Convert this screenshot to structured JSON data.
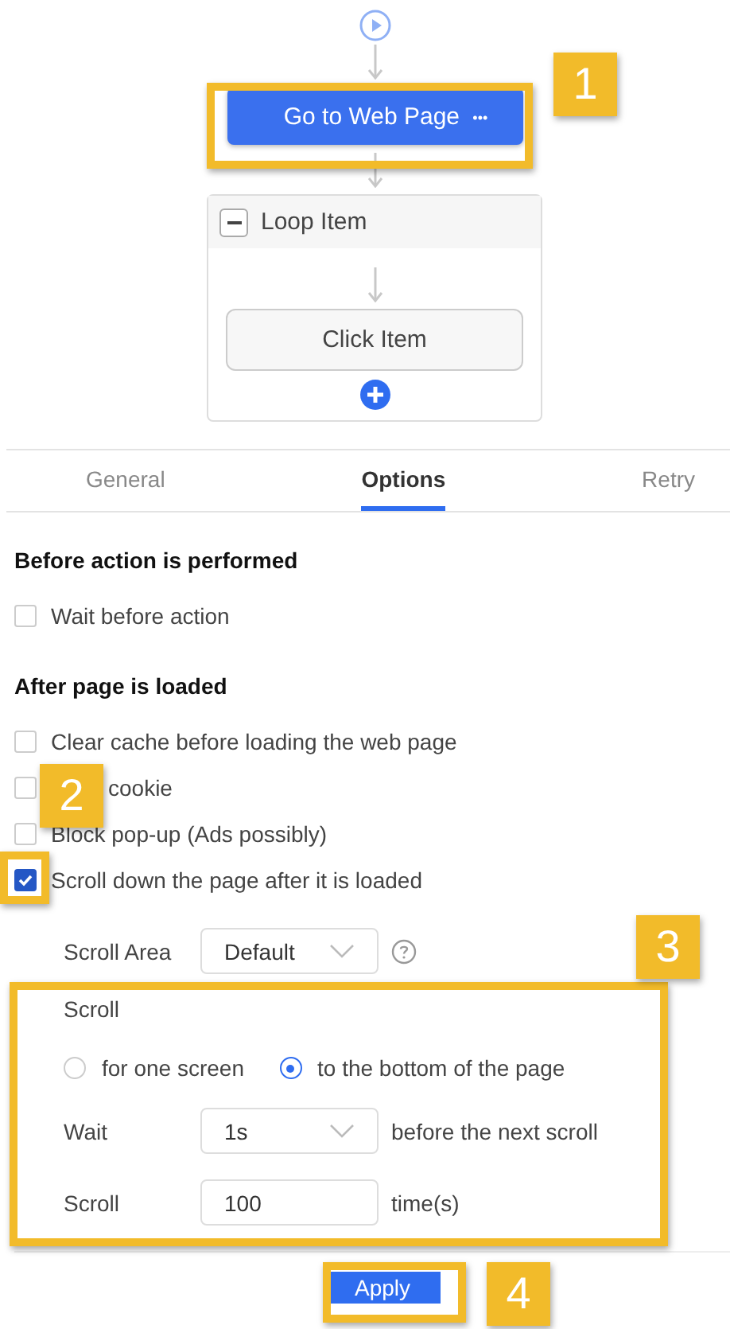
{
  "flow": {
    "start": {
      "kind": "start"
    },
    "step": {
      "label": "Go to Web Page",
      "more": "•••"
    },
    "loop": {
      "title": "Loop Item",
      "expanded": true,
      "children": [
        {
          "label": "Click Item"
        }
      ]
    }
  },
  "tabs": [
    {
      "label": "General",
      "selected": false
    },
    {
      "label": "Options",
      "selected": true
    },
    {
      "label": "Retry",
      "selected": false
    }
  ],
  "sections": [
    {
      "title": "Before action is performed",
      "options": [
        {
          "label": "Wait before action",
          "checked": false
        }
      ]
    },
    {
      "title": "After page is loaded",
      "options": [
        {
          "label": "Clear cache before loading the web page",
          "checked": false
        },
        {
          "label": "cookie",
          "checked": false
        },
        {
          "label": "Block pop-up (Ads possibly)",
          "checked": false
        },
        {
          "label": "Scroll down the page after it is loaded",
          "checked": true
        }
      ]
    }
  ],
  "scroll_area": {
    "label": "Scroll Area",
    "value": "Default"
  },
  "scroll": {
    "title": "Scroll",
    "modes": [
      {
        "label": "for one screen",
        "selected": false
      },
      {
        "label": "to the bottom of the page",
        "selected": true
      }
    ],
    "wait": {
      "label": "Wait",
      "value": "1s",
      "suffix": "before the next scroll"
    },
    "times": {
      "label": "Scroll",
      "value": "100",
      "suffix": "time(s)"
    }
  },
  "apply": "Apply",
  "callouts": [
    "1",
    "2",
    "3",
    "4"
  ]
}
